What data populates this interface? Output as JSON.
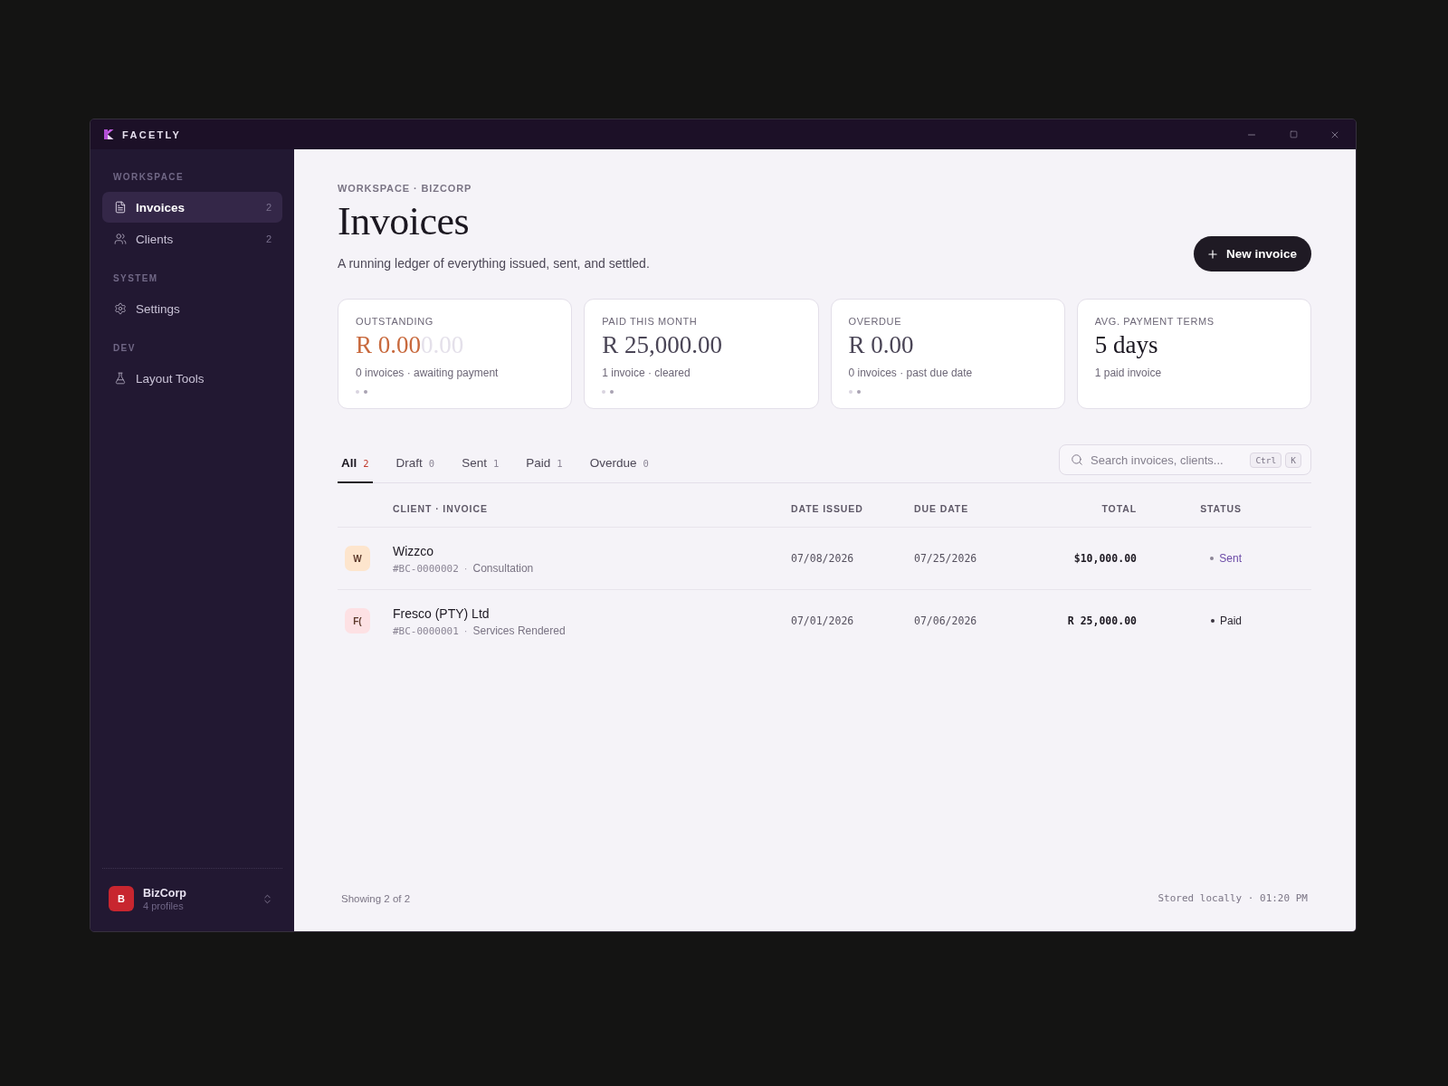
{
  "window": {
    "app_name": "FACETLY"
  },
  "sidebar": {
    "sections": [
      {
        "title": "WORKSPACE",
        "items": [
          {
            "label": "Invoices",
            "count": "2",
            "selected": true
          },
          {
            "label": "Clients",
            "count": "2",
            "selected": false
          }
        ]
      },
      {
        "title": "SYSTEM",
        "items": [
          {
            "label": "Settings",
            "selected": false
          }
        ]
      },
      {
        "title": "DEV",
        "items": [
          {
            "label": "Layout Tools",
            "selected": false
          }
        ]
      }
    ],
    "workspace": {
      "initial": "B",
      "color": "#c8262f",
      "name": "BizCorp",
      "profiles": "4 profiles"
    }
  },
  "header": {
    "breadcrumb": "WORKSPACE · BIZCORP",
    "title": "Invoices",
    "subtitle": "A running ledger of everything issued, sent, and settled.",
    "new_button": "New invoice"
  },
  "stats": [
    {
      "label": "OUTSTANDING",
      "value": "R 0.00",
      "ghost": "0.00",
      "color": "#c8693d",
      "caption": "0 invoices · awaiting payment",
      "dots": [
        {
          "active": false
        },
        {
          "active": true
        }
      ]
    },
    {
      "label": "PAID THIS MONTH",
      "value": "R 25,000.00",
      "color": "#4a4556",
      "caption": "1 invoice · cleared",
      "dots": [
        {
          "active": false
        },
        {
          "active": true
        }
      ]
    },
    {
      "label": "OVERDUE",
      "value": "R 0.00",
      "color": "#4a4556",
      "caption": "0 invoices · past due date",
      "dots": [
        {
          "active": false
        },
        {
          "active": true
        }
      ]
    },
    {
      "label": "AVG. PAYMENT TERMS",
      "value": "5 days",
      "color": "#1a1620",
      "caption": "1 paid invoice"
    }
  ],
  "tabs": [
    {
      "label": "All",
      "count": "2",
      "selected": true
    },
    {
      "label": "Draft",
      "count": "0",
      "selected": false
    },
    {
      "label": "Sent",
      "count": "1",
      "selected": false
    },
    {
      "label": "Paid",
      "count": "1",
      "selected": false
    },
    {
      "label": "Overdue",
      "count": "0",
      "selected": false
    }
  ],
  "search": {
    "placeholder": "Search invoices, clients...",
    "shortcut": [
      "Ctrl",
      "K"
    ]
  },
  "table": {
    "columns": [
      "CLIENT · INVOICE",
      "DATE ISSUED",
      "DUE DATE",
      "TOTAL",
      "STATUS"
    ],
    "rows": [
      {
        "initials": "W",
        "color": "#fde5cd",
        "client": "Wizzco",
        "number": "#BC-0000002",
        "separator": "·",
        "description": "Consultation",
        "issued": "07/08/2026",
        "due": "07/25/2026",
        "total": "$10,000.00",
        "status": {
          "label": "Sent",
          "kind": "sent"
        }
      },
      {
        "initials": "F(",
        "color": "#fde1e4",
        "client": "Fresco (PTY) Ltd",
        "number": "#BC-0000001",
        "separator": "·",
        "description": "Services Rendered",
        "issued": "07/01/2026",
        "due": "07/06/2026",
        "total": "R 25,000.00",
        "status": {
          "label": "Paid",
          "kind": "paid"
        }
      }
    ]
  },
  "footer": {
    "showing": "Showing 2 of 2",
    "storage": "Stored locally · 01:20 PM"
  }
}
